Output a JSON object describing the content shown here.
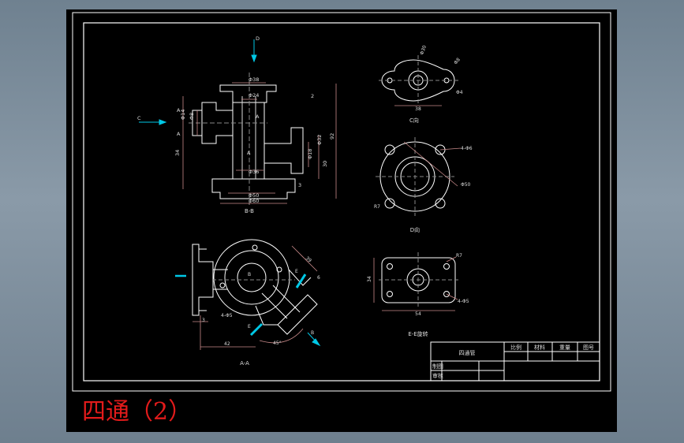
{
  "caption": "四通（2）",
  "colors": {
    "background": "#000000",
    "outline": "#ffffff",
    "dimension": "#c98a8a",
    "section_arrow": "#00c8e6",
    "caption": "#e21b1b"
  },
  "views": {
    "section_bb": {
      "title": "B-B",
      "dims": [
        "Φ38",
        "Φ24",
        "Φ14",
        "Φ8",
        "Φ32",
        "Φ18",
        "Φ36",
        "Φ50",
        "Φ60",
        "34",
        "92",
        "30",
        "2",
        "3"
      ],
      "marks": [
        "A",
        "A",
        "A",
        "A",
        "C",
        "D"
      ]
    },
    "view_c": {
      "title": "C向",
      "dims": [
        "Φ30",
        "Φ8",
        "Φ4",
        "38"
      ]
    },
    "view_d": {
      "title": "D向",
      "dims": [
        "4-Φ6",
        "Φ50",
        "R7"
      ]
    },
    "section_aa": {
      "title": "A-A",
      "dims": [
        "39",
        "6",
        "4-Φ5",
        "3",
        "42",
        "45°"
      ],
      "marks": [
        "B",
        "B",
        "E",
        "E"
      ]
    },
    "view_ee": {
      "title": "E-E旋转",
      "dims": [
        "R7",
        "34",
        "54",
        "4-Φ5"
      ]
    }
  },
  "title_block": {
    "part_name": "四通管",
    "headers": [
      "比例",
      "材料",
      "重量",
      "图号"
    ],
    "roles": [
      "制图",
      "审核"
    ]
  }
}
